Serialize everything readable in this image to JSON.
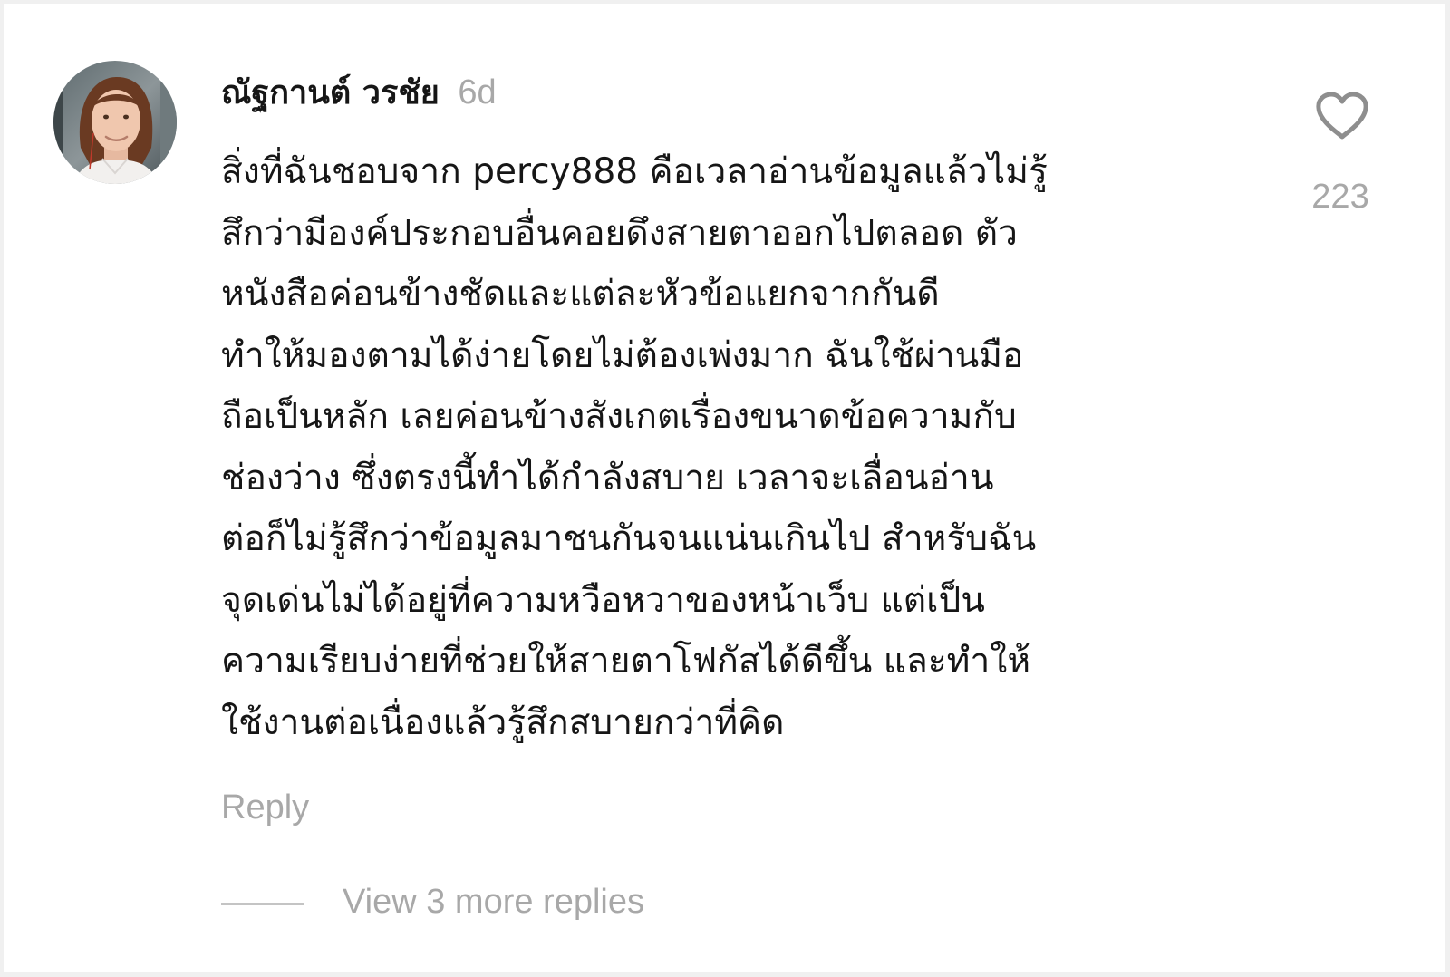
{
  "comment": {
    "username": "ณัฐกานต์ วรชัย",
    "timestamp": "6d",
    "body_lines": [
      "สิ่งที่ฉันชอบจาก percy888 คือเวลาอ่านข้อมูลแล้วไม่รู้",
      "สึกว่ามีองค์ประกอบอื่นคอยดึงสายตาออกไปตลอด ตัว",
      "หนังสือค่อนข้างชัดและแต่ละหัวข้อแยกจากกันดี",
      "ทำให้มองตามได้ง่ายโดยไม่ต้องเพ่งมาก ฉันใช้ผ่านมือ",
      "ถือเป็นหลัก เลยค่อนข้างสังเกตเรื่องขนาดข้อความกับ",
      "ช่องว่าง ซึ่งตรงนี้ทำได้กำลังสบาย เวลาจะเลื่อนอ่าน",
      "ต่อก็ไม่รู้สึกว่าข้อมูลมาชนกันจนแน่นเกินไป สำหรับฉัน",
      "จุดเด่นไม่ได้อยู่ที่ความหวือหวาของหน้าเว็บ แต่เป็น",
      "ความเรียบง่ายที่ช่วยให้สายตาโฟกัสได้ดีขึ้น และทำให้",
      "ใช้งานต่อเนื่องแล้วรู้สึกสบายกว่าที่คิด"
    ],
    "like_count": "223",
    "like_icon": "heart-outline-icon",
    "reply_label": "Reply",
    "view_replies_label": "View 3 more replies"
  },
  "colors": {
    "text_primary": "#161616",
    "text_secondary": "#a8a8a8",
    "divider": "#c4c4c4",
    "background": "#ffffff"
  }
}
